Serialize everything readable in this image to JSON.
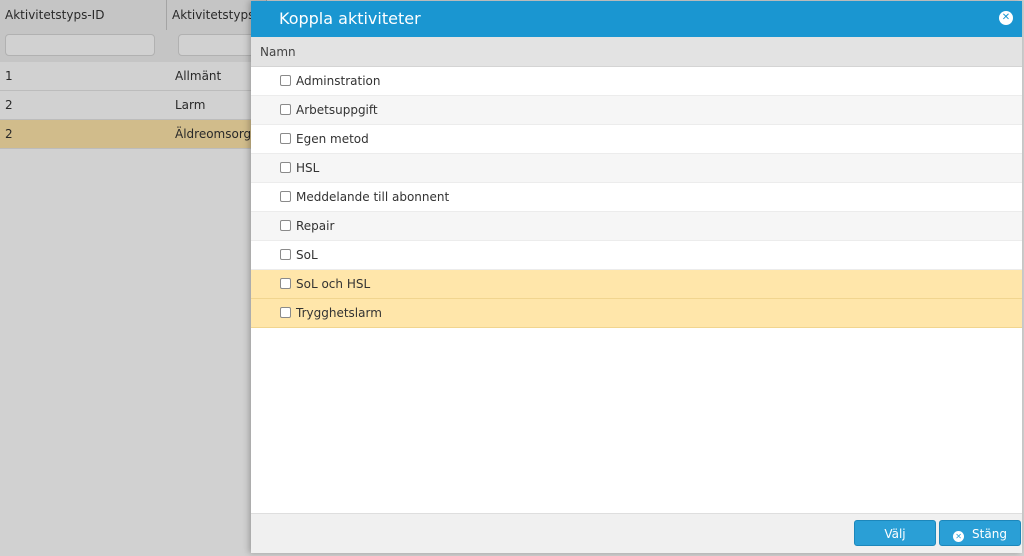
{
  "background": {
    "columns": [
      "Aktivitetstyps-ID",
      "Aktivitetstypsn"
    ],
    "rows": [
      {
        "id": "1",
        "name": "Allmänt",
        "highlight": false
      },
      {
        "id": "2",
        "name": "Larm",
        "highlight": false
      },
      {
        "id": "2",
        "name": "Äldreomsorg Å",
        "highlight": true
      }
    ]
  },
  "dialog": {
    "title": "Koppla aktiviteter",
    "close_icon": "close-circle-icon",
    "column_header": "Namn",
    "items": [
      {
        "label": "Adminstration",
        "checked": false,
        "selected": false
      },
      {
        "label": "Arbetsuppgift",
        "checked": false,
        "selected": false
      },
      {
        "label": "Egen metod",
        "checked": false,
        "selected": false
      },
      {
        "label": "HSL",
        "checked": false,
        "selected": false
      },
      {
        "label": "Meddelande till abonnent",
        "checked": false,
        "selected": false
      },
      {
        "label": "Repair",
        "checked": false,
        "selected": false
      },
      {
        "label": "SoL",
        "checked": false,
        "selected": false
      },
      {
        "label": "SoL och HSL",
        "checked": false,
        "selected": true
      },
      {
        "label": "Trygghetslarm",
        "checked": false,
        "selected": true
      }
    ],
    "buttons": {
      "select": "Välj",
      "close": "Stäng"
    }
  },
  "colors": {
    "accent": "#1a96d1",
    "selected_row": "#ffe6aa"
  }
}
